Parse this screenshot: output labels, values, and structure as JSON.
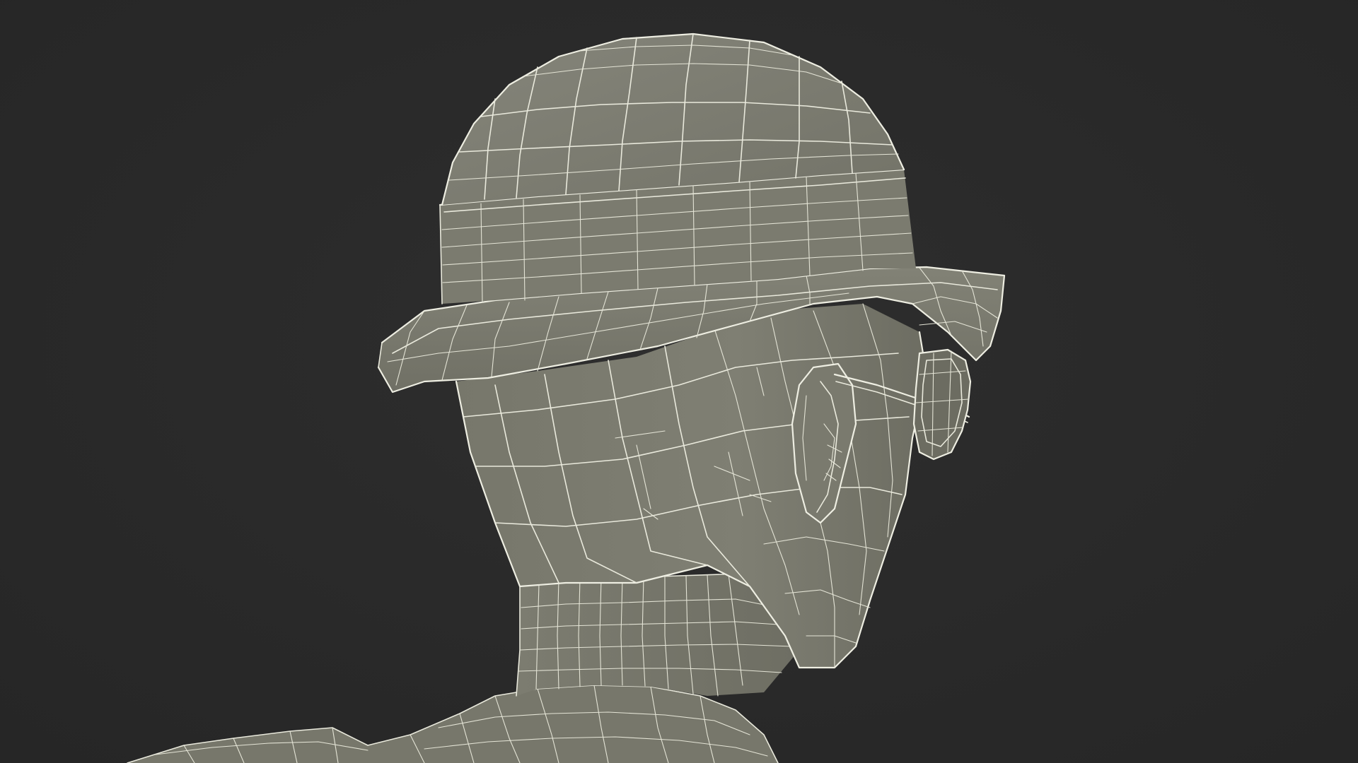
{
  "scene": {
    "subject": "hat-head-wireframe-render",
    "colors": {
      "background": "#2a2a2a",
      "surface": "#7d7d70",
      "surface_light": "#8a8a7d",
      "surface_dark": "#6a6a5e",
      "wireframe": "#e9e9dc"
    }
  }
}
